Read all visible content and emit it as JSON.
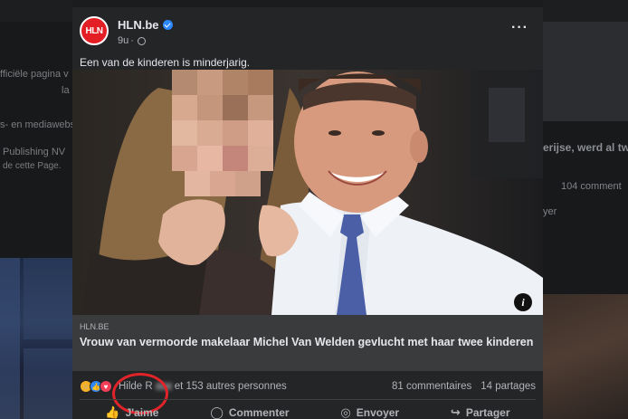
{
  "background_left": {
    "lines": [
      "fficiële pagina v",
      "la",
      "s- en mediawebs",
      "Publishing NV",
      "de cette Page."
    ]
  },
  "background_right": {
    "snippet": "erijse, werd al tw",
    "comments": "104 comment",
    "share": "yer"
  },
  "post": {
    "page_name": "HLN.be",
    "logo_text": "HLN",
    "time": "9u",
    "caption": "Een van de kinderen is minderjarig.",
    "link": {
      "domain": "HLN.BE",
      "headline": "Vrouw van vermoorde makelaar Michel Van Welden gevlucht met haar twee kinderen"
    },
    "stats": {
      "reactors_prefix": "Hilde R",
      "reactors_suffix": "et 153 autres personnes",
      "comments": "81 commentaires",
      "shares": "14 partages"
    },
    "actions": {
      "like": "J'aime",
      "comment": "Commenter",
      "send": "Envoyer",
      "share": "Partager"
    }
  },
  "colors": {
    "card": "#242526",
    "link_box": "#3a3b3c",
    "brand_red": "#e31e24",
    "verified": "#2d88ff",
    "annotation": "#e0242a"
  }
}
